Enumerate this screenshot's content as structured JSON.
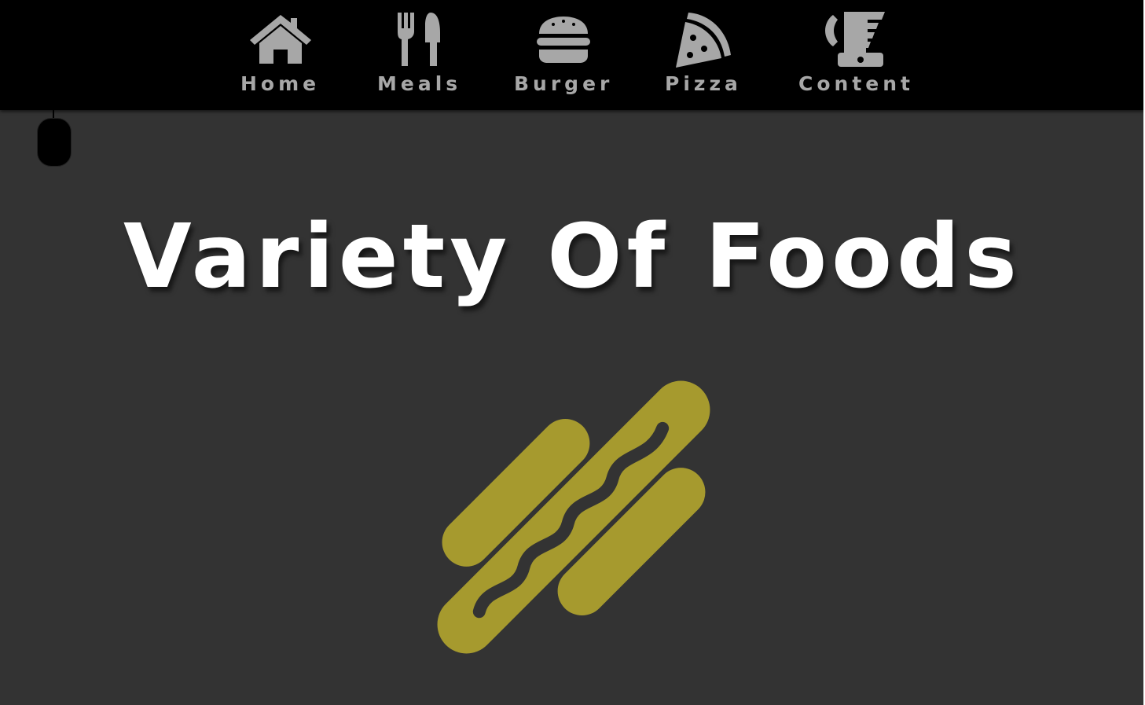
{
  "nav": {
    "items": [
      {
        "label": "Home",
        "icon": "home-icon"
      },
      {
        "label": "Meals",
        "icon": "utensils-icon"
      },
      {
        "label": "Burger",
        "icon": "burger-icon"
      },
      {
        "label": "Pizza",
        "icon": "pizza-icon"
      },
      {
        "label": "Content",
        "icon": "phone-fax-icon"
      }
    ]
  },
  "hero": {
    "title": "Variety Of Foods",
    "logo_icon": "hotdog-icon"
  },
  "colors": {
    "background": "#333333",
    "navbar": "#000000",
    "nav_icon": "#a7a7a7",
    "title": "#ffffff",
    "logo": "#a69a2e"
  }
}
